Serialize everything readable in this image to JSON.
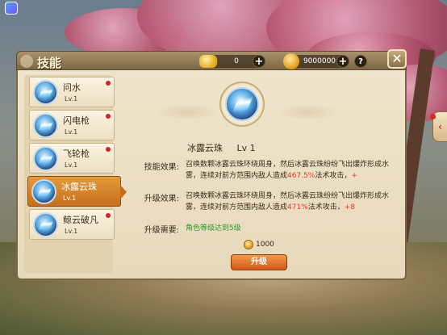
{
  "window": {
    "title": "技能"
  },
  "resources": {
    "gold": {
      "icon": "gold-ingot-icon",
      "value": "0"
    },
    "coins": {
      "icon": "coin-icon",
      "value": "9000000"
    }
  },
  "controls": {
    "plus": "+",
    "help": "?",
    "close": "✕"
  },
  "skills": [
    {
      "name": "问水",
      "level": "Lv.1",
      "icon": "skill-icon",
      "active": false
    },
    {
      "name": "闪电枪",
      "level": "Lv.1",
      "icon": "skill-icon",
      "active": false
    },
    {
      "name": "飞轮枪",
      "level": "Lv.1",
      "icon": "skill-icon",
      "active": false
    },
    {
      "name": "冰露云珠",
      "level": "Lv.1",
      "icon": "skill-icon",
      "active": true
    },
    {
      "name": "鲸云破凡",
      "level": "Lv.1",
      "icon": "skill-icon",
      "active": false
    }
  ],
  "detail": {
    "name": "冰露云珠",
    "level": "Lv 1",
    "effect_label": "技能效果:",
    "effect_text_a": "召唤数颗冰露云珠环绕周身，然后冰露云珠纷纷飞出爆炸形成水雾，连续对前方范围内敌人造成",
    "effect_pct": "467.5%",
    "effect_text_b": "法术攻击，",
    "effect_plus": "+",
    "upgrade_label": "升级效果:",
    "upgrade_text_a": "召唤数颗冰露云珠环绕周身，然后冰露云珠纷纷飞出爆炸形成水雾，连续对前方范围内敌人造成",
    "upgrade_pct": "471%",
    "upgrade_text_b": "法术攻击，",
    "upgrade_plus": "+8",
    "need_label": "升级需要:",
    "need_text": "角色等级达到5级",
    "cost": "1000",
    "upgrade_button": "升级"
  },
  "colors": {
    "accent": "#d2581b",
    "highlight": "#e43a2a",
    "requirement": "#2f9a2c"
  }
}
